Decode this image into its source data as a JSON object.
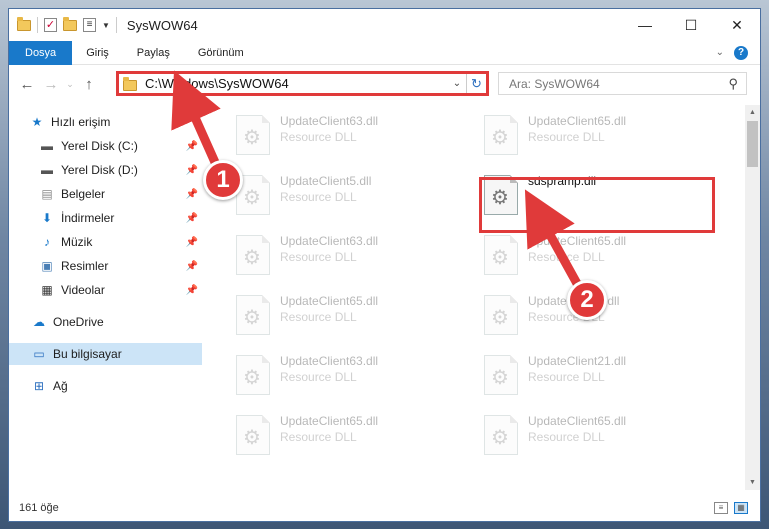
{
  "window": {
    "title": "SysWOW64",
    "controls": {
      "minimize": "—",
      "maximize": "☐",
      "close": "✕"
    }
  },
  "ribbon": {
    "tabs": [
      "Dosya",
      "Giriş",
      "Paylaş",
      "Görünüm"
    ],
    "active_tab": "Dosya",
    "accent": "#1979ca",
    "help": "?"
  },
  "nav": {
    "address": "C:\\Windows\\SysWOW64",
    "search_placeholder": "Ara: SysWOW64"
  },
  "sidebar": {
    "items": [
      {
        "label": "Hızlı erişim",
        "icon": "star-icon",
        "pinned": false
      },
      {
        "label": "Yerel Disk (C:)",
        "icon": "drive-icon",
        "pinned": true
      },
      {
        "label": "Yerel Disk (D:)",
        "icon": "drive-icon",
        "pinned": true
      },
      {
        "label": "Belgeler",
        "icon": "documents-icon",
        "pinned": true
      },
      {
        "label": "İndirmeler",
        "icon": "download-icon",
        "pinned": true
      },
      {
        "label": "Müzik",
        "icon": "music-icon",
        "pinned": true
      },
      {
        "label": "Resimler",
        "icon": "pictures-icon",
        "pinned": true
      },
      {
        "label": "Videolar",
        "icon": "video-icon",
        "pinned": true
      },
      {
        "label": "OneDrive",
        "icon": "cloud-icon",
        "pinned": false
      },
      {
        "label": "Bu bilgisayar",
        "icon": "computer-icon",
        "pinned": false,
        "selected": true
      },
      {
        "label": "Ağ",
        "icon": "network-icon",
        "pinned": false
      }
    ]
  },
  "files": [
    {
      "name": "UpdateClient63.dll",
      "type": "Resource DLL",
      "faded": true
    },
    {
      "name": "UpdateClient65.dll",
      "type": "Resource DLL",
      "faded": true
    },
    {
      "name": "UpdateClient5.dll",
      "type": "Resource DLL",
      "faded": true
    },
    {
      "name": "sdspramp.dll",
      "type": "",
      "faded": false
    },
    {
      "name": "UpdateClient63.dll",
      "type": "Resource DLL",
      "faded": true
    },
    {
      "name": "UpdateClient65.dll",
      "type": "Resource DLL",
      "faded": true
    },
    {
      "name": "UpdateClient65.dll",
      "type": "Resource DLL",
      "faded": true
    },
    {
      "name": "UpdateClient1.dll",
      "type": "Resource DLL",
      "faded": true
    },
    {
      "name": "UpdateClient63.dll",
      "type": "Resource DLL",
      "faded": true
    },
    {
      "name": "UpdateClient21.dll",
      "type": "Resource DLL",
      "faded": true
    },
    {
      "name": "UpdateClient65.dll",
      "type": "Resource DLL",
      "faded": true
    },
    {
      "name": "UpdateClient65.dll",
      "type": "Resource DLL",
      "faded": true
    }
  ],
  "status": {
    "count": "161 öğe"
  },
  "annotations": {
    "badge1": "1",
    "badge2": "2",
    "color": "#e03a3a"
  }
}
